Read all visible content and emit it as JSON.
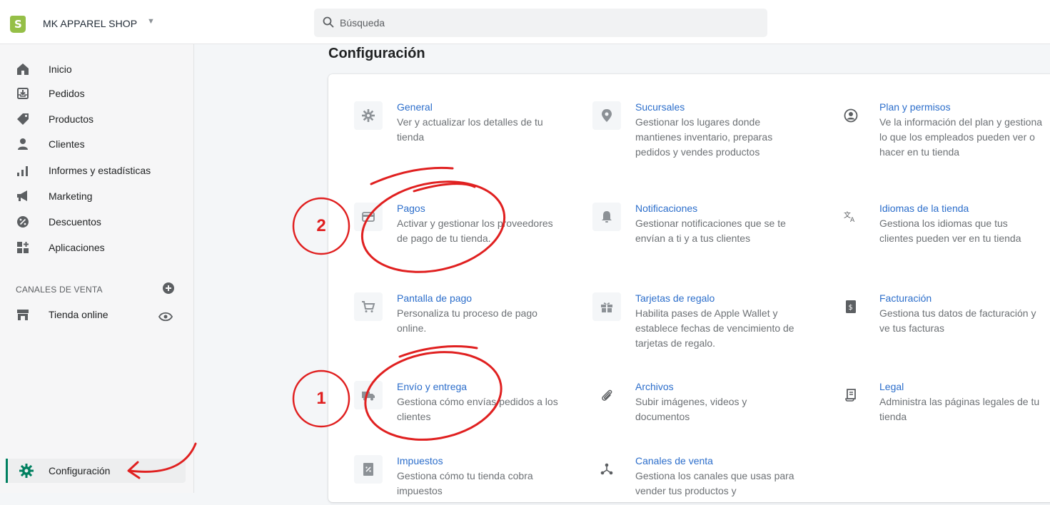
{
  "topbar": {
    "store_name": "MK APPAREL SHOP",
    "search_placeholder": "Búsqueda"
  },
  "sidebar": {
    "items": [
      {
        "label": "Inicio",
        "icon": "home-icon"
      },
      {
        "label": "Pedidos",
        "icon": "orders-icon"
      },
      {
        "label": "Productos",
        "icon": "tag-icon"
      },
      {
        "label": "Clientes",
        "icon": "person-icon"
      },
      {
        "label": "Informes y estadísticas",
        "icon": "analytics-icon"
      },
      {
        "label": "Marketing",
        "icon": "megaphone-icon"
      },
      {
        "label": "Descuentos",
        "icon": "discount-icon"
      },
      {
        "label": "Aplicaciones",
        "icon": "apps-icon"
      }
    ],
    "channels_heading": "CANALES DE VENTA",
    "channel_online_store": "Tienda online",
    "settings_label": "Configuración"
  },
  "main": {
    "title": "Configuración",
    "settings": [
      {
        "title": "General",
        "desc": "Ver y actualizar los detalles de tu tienda",
        "icon": "gear-icon"
      },
      {
        "title": "Sucursales",
        "desc": "Gestionar los lugares donde mantienes inventario, preparas pedidos y vendes productos",
        "icon": "location-pin-icon"
      },
      {
        "title": "Plan y permisos",
        "desc": "Ve la información del plan y gestiona lo que los empleados pueden ver o hacer en tu tienda",
        "icon": "account-icon"
      },
      {
        "title": "Pagos",
        "desc": "Activar y gestionar los proveedores de pago de tu tienda.",
        "icon": "credit-card-icon"
      },
      {
        "title": "Notificaciones",
        "desc": "Gestionar notificaciones que se te envían a ti y a tus clientes",
        "icon": "bell-icon"
      },
      {
        "title": "Idiomas de la tienda",
        "desc": "Gestiona los idiomas que tus clientes pueden ver en tu tienda",
        "icon": "translate-icon"
      },
      {
        "title": "Pantalla de pago",
        "desc": "Personaliza tu proceso de pago online.",
        "icon": "cart-icon"
      },
      {
        "title": "Tarjetas de regalo",
        "desc": "Habilita pases de Apple Wallet y establece fechas de vencimiento de tarjetas de regalo.",
        "icon": "gift-icon"
      },
      {
        "title": "Facturación",
        "desc": "Gestiona tus datos de facturación y ve tus facturas",
        "icon": "billing-icon"
      },
      {
        "title": "Envío y entrega",
        "desc": "Gestiona cómo envías pedidos a los clientes",
        "icon": "truck-icon"
      },
      {
        "title": "Archivos",
        "desc": "Subir imágenes, videos y documentos",
        "icon": "paperclip-icon"
      },
      {
        "title": "Legal",
        "desc": "Administra las páginas legales de tu tienda",
        "icon": "legal-document-icon"
      },
      {
        "title": "Impuestos",
        "desc": "Gestiona cómo tu tienda cobra impuestos",
        "icon": "tax-icon"
      },
      {
        "title": "Canales de venta",
        "desc": "Gestiona los canales que usas para vender tus productos y",
        "icon": "channels-icon"
      }
    ]
  },
  "annotations": {
    "step_pagos": "2",
    "step_envio": "1"
  },
  "colors": {
    "accent_link": "#2c6ecb",
    "annotation_red": "#e02020",
    "active_bar": "#008060",
    "shopify_green": "#95bf47"
  }
}
